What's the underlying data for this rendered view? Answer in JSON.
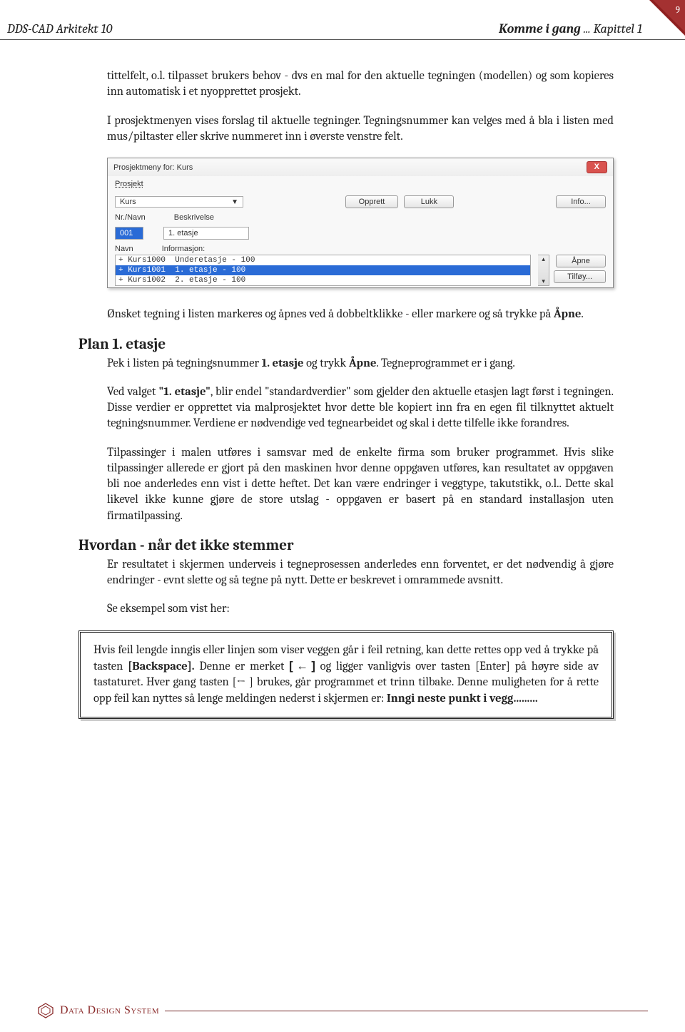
{
  "header": {
    "left": "DDS-CAD Arkitekt 10",
    "right_bold": "Komme i gang",
    "right_rest": " ... Kapittel 1"
  },
  "page_number": "9",
  "para1": "tittelfelt, o.l. tilpasset brukers behov - dvs en mal for den aktuelle tegningen (modellen) og som kopieres inn automatisk i et nyopprettet prosjekt.",
  "para2": "I prosjektmenyen vises forslag til aktuelle tegninger. Tegningsnummer kan velges med å bla i listen med mus/piltaster eller skrive nummeret inn i øverste venstre felt.",
  "screenshot": {
    "title": "Prosjektmeny for: Kurs",
    "close": "X",
    "project_label": "Prosjekt",
    "project_value": "Kurs",
    "btn_opprett": "Opprett",
    "btn_lukk": "Lukk",
    "btn_info": "Info...",
    "col_nr": "Nr./Navn",
    "col_besk": "Beskrivelse",
    "nr_value": "001",
    "besk_value": "1. etasje",
    "navn_label": "Navn",
    "info_label": "Informasjon:",
    "list": {
      "row1": "+ Kurs1000  Underetasje - 100",
      "row2": "+ Kurs1001  1. etasje - 100",
      "row3": "+ Kurs1002  2. etasje - 100"
    },
    "btn_apne": "Åpne",
    "btn_tilfoy": "Tilføy..."
  },
  "para3_a": "Ønsket tegning i listen markeres og åpnes ved å dobbeltklikke - eller markere og så trykke på ",
  "para3_b": "Åpne",
  "para3_c": ".",
  "h2_plan": "Plan 1. etasje",
  "para4_a": "Pek i listen på tegningsnummer  ",
  "para4_b": "1. etasje",
  "para4_c": " og trykk ",
  "para4_d": "Åpne",
  "para4_e": ". Tegneprogrammet er i gang.",
  "para5_a": "Ved valget ",
  "para5_b": "\"1. etasje\"",
  "para5_c": ", blir endel \"standardverdier\" som gjelder den aktuelle etasjen lagt først i tegningen. Disse verdier er opprettet via malprosjektet hvor dette ble kopiert inn fra en egen fil tilknyttet aktuelt tegningsnummer. Verdiene er nødvendige ved tegnearbeidet og skal i dette tilfelle ikke forandres.",
  "para6": "Tilpassinger i malen utføres i samsvar med de enkelte firma som bruker programmet. Hvis slike tilpassinger allerede er gjort på den maskinen hvor denne oppgaven utføres, kan resultatet av oppgaven bli noe anderledes enn vist i dette heftet. Det kan være endringer i veggtype, takutstikk, o.l.. Dette skal likevel ikke kunne gjøre de store utslag - oppgaven er basert på en standard installasjon uten firmatilpassing.",
  "h2_hvordan": "Hvordan - når det ikke stemmer",
  "para7": "Er resultatet i skjermen underveis i tegneprosessen anderledes enn forventet, er det nødvendig å gjøre endringer - evnt slette og så tegne på nytt. Dette er beskrevet i omrammede avsnitt.",
  "para8": "Se eksempel som vist her:",
  "box_a": "Hvis feil lengde inngis eller linjen som viser veggen går i feil retning, kan dette rettes opp ved å trykke på tasten ",
  "box_b": "[Backspace].",
  "box_c": " Denne er merket ",
  "box_d": "[    ←    ]",
  "box_e": " og ligger vanligvis over tasten [Enter] på høyre side av tastaturet. Hver gang tasten [←      ] brukes, går programmet et trinn tilbake. Denne muligheten for å rette opp feil kan nyttes så lenge meldingen nederst i skjermen er: ",
  "box_f": "Inngi neste punkt i vegg.........",
  "footer_brand": "Data Design System"
}
